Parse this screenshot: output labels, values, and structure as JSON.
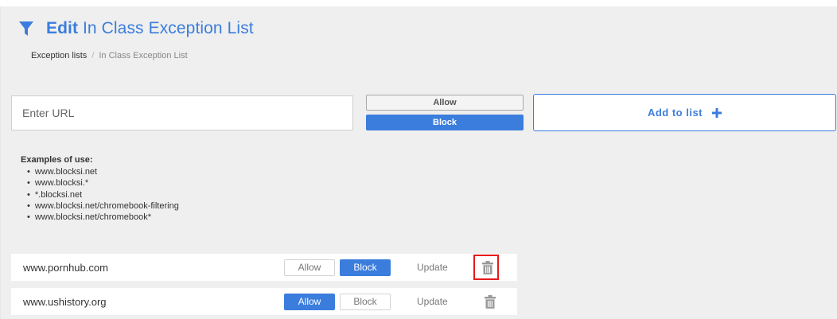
{
  "header": {
    "title_bold": "Edit",
    "title_rest": "In Class Exception List"
  },
  "breadcrumb": {
    "parent": "Exception lists",
    "separator": "/",
    "current": "In Class Exception List"
  },
  "url_input": {
    "placeholder": "Enter URL",
    "value": ""
  },
  "mode_toggle": {
    "allow_label": "Allow",
    "block_label": "Block",
    "selected": "Block"
  },
  "add_button": {
    "label": "Add to list",
    "icon": "plus-icon"
  },
  "examples": {
    "title": "Examples of use:",
    "items": [
      "www.blocksi.net",
      "www.blocksi.*",
      "*.blocksi.net",
      "www.blocksi.net/chromebook-filtering",
      "www.blocksi.net/chromebook*"
    ]
  },
  "entries": [
    {
      "host": "www.pornhub.com",
      "allow_label": "Allow",
      "block_label": "Block",
      "selected": "Block",
      "update_label": "Update",
      "delete_icon": "trash-icon",
      "delete_highlighted": true
    },
    {
      "host": "www.ushistory.org",
      "allow_label": "Allow",
      "block_label": "Block",
      "selected": "Allow",
      "update_label": "Update",
      "delete_icon": "trash-icon",
      "delete_highlighted": false
    }
  ],
  "colors": {
    "accent": "#3b7ddd",
    "highlight": "#e8191b",
    "background": "#efefef"
  }
}
